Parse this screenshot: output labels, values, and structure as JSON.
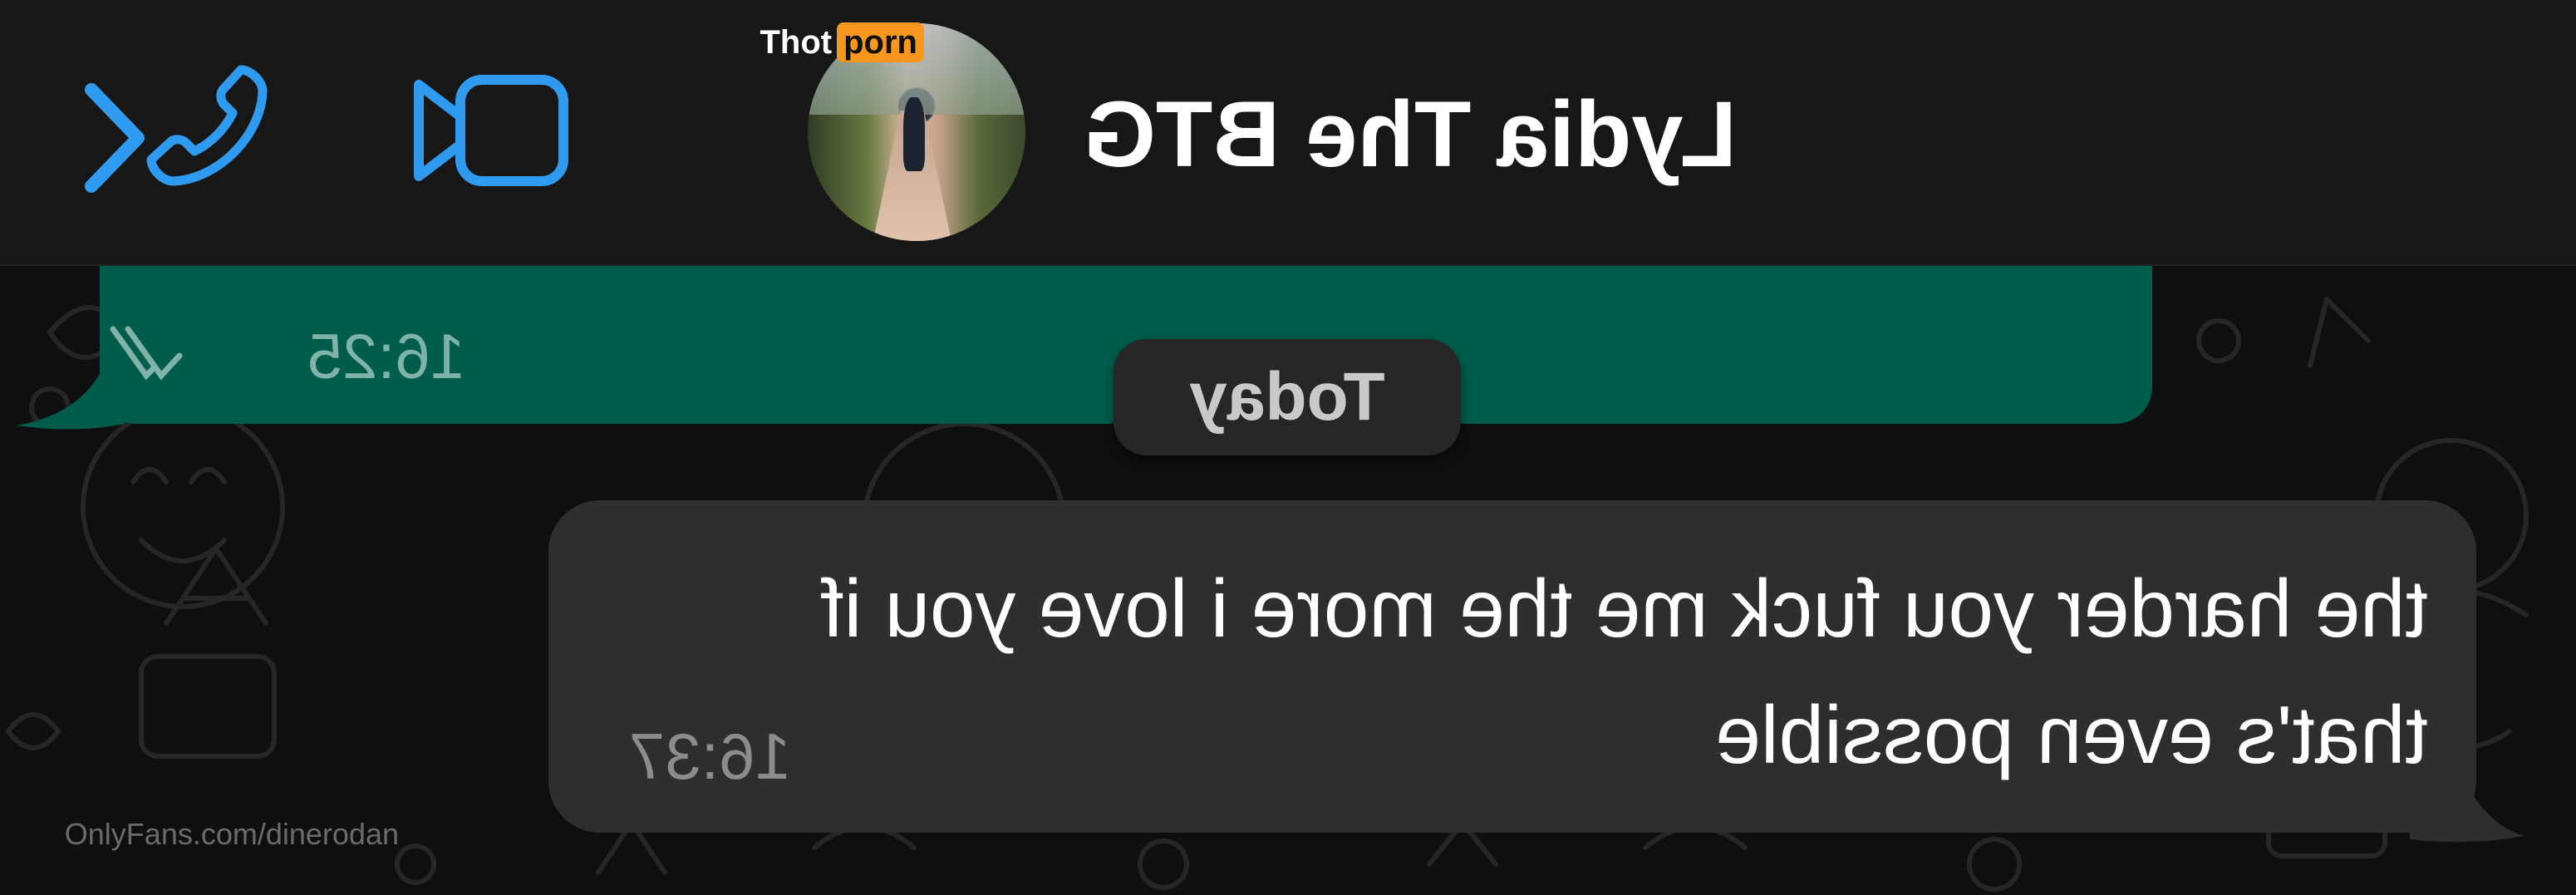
{
  "header": {
    "contact_name": "Lydia The BTG",
    "back_icon": "chevron-left-icon",
    "video_icon": "video-camera-icon",
    "phone_icon": "phone-icon",
    "accent_color": "#2f9bf0"
  },
  "overlay": {
    "logo_part1": "Thot",
    "logo_part2": "porn",
    "logo_accent": "#f7971d",
    "watermark": "OnlyFans.com/dinerodan"
  },
  "chat": {
    "date_separator": "Today",
    "messages": [
      {
        "direction": "outgoing",
        "text": "",
        "time": "16:25",
        "status_icon": "double-check-icon",
        "bubble_color": "#005c4b"
      },
      {
        "direction": "incoming",
        "text": "the harder you fuck me the more i love you if that's even possible",
        "time": "16:37",
        "bubble_color": "#2e2e2e"
      }
    ]
  },
  "display": {
    "mirrored_horizontally": true
  }
}
